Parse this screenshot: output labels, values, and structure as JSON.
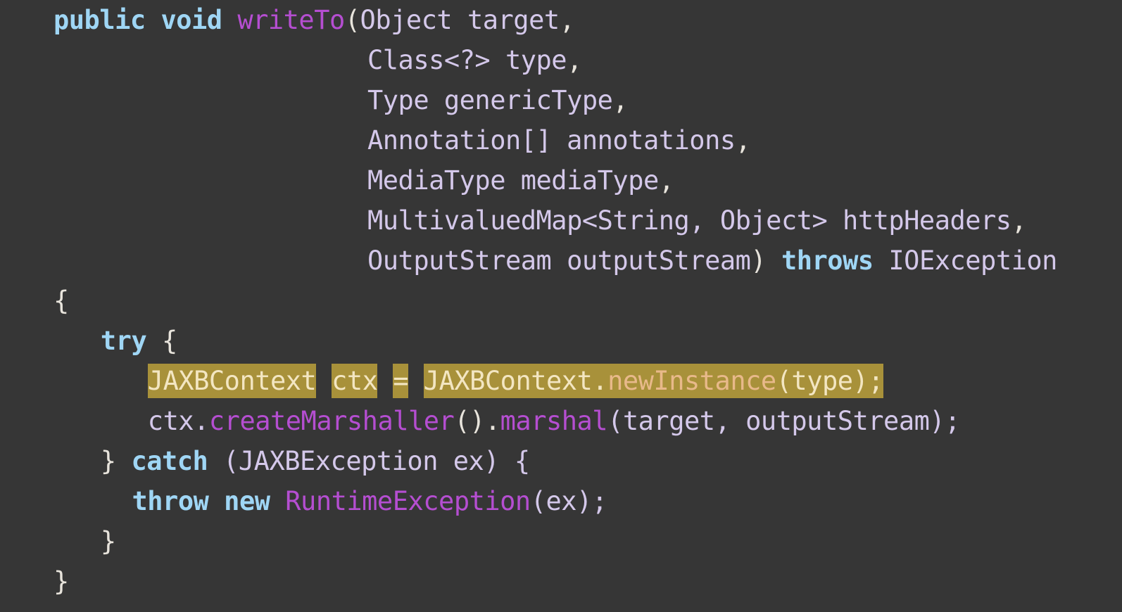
{
  "code": {
    "lines": [
      {
        "indent": 0,
        "tokens": [
          {
            "text": "public",
            "kind": "kw"
          },
          {
            "text": " ",
            "kind": "pu"
          },
          {
            "text": "void",
            "kind": "kw"
          },
          {
            "text": " ",
            "kind": "pu"
          },
          {
            "text": "writeTo",
            "kind": "fn"
          },
          {
            "text": "(",
            "kind": "pu"
          },
          {
            "text": "Object target",
            "kind": "ty"
          },
          {
            "text": ",",
            "kind": "pu"
          }
        ]
      },
      {
        "indent": 20,
        "tokens": [
          {
            "text": "Class<?> type",
            "kind": "ty"
          },
          {
            "text": ",",
            "kind": "pu"
          }
        ]
      },
      {
        "indent": 20,
        "tokens": [
          {
            "text": "Type genericType",
            "kind": "ty"
          },
          {
            "text": ",",
            "kind": "pu"
          }
        ]
      },
      {
        "indent": 20,
        "tokens": [
          {
            "text": "Annotation[] annotations",
            "kind": "ty"
          },
          {
            "text": ",",
            "kind": "pu"
          }
        ]
      },
      {
        "indent": 20,
        "tokens": [
          {
            "text": "MediaType mediaType",
            "kind": "ty"
          },
          {
            "text": ",",
            "kind": "pu"
          }
        ]
      },
      {
        "indent": 20,
        "tokens": [
          {
            "text": "MultivaluedMap<String, Object> httpHeaders",
            "kind": "ty"
          },
          {
            "text": ",",
            "kind": "pu"
          }
        ]
      },
      {
        "indent": 20,
        "tokens": [
          {
            "text": "OutputStream outputStream",
            "kind": "ty"
          },
          {
            "text": ") ",
            "kind": "pu"
          },
          {
            "text": "throws",
            "kind": "kw"
          },
          {
            "text": " ",
            "kind": "pu"
          },
          {
            "text": "IOException",
            "kind": "ty"
          }
        ]
      },
      {
        "indent": 0,
        "tokens": [
          {
            "text": "{",
            "kind": "pu"
          }
        ]
      },
      {
        "indent": 3,
        "tokens": [
          {
            "text": "try",
            "kind": "kw"
          },
          {
            "text": " {",
            "kind": "pu"
          }
        ]
      },
      {
        "indent": 6,
        "tokens": [
          {
            "text": "JAXBContext",
            "kind": "hl"
          },
          {
            "text": " ",
            "kind": "pu"
          },
          {
            "text": "ctx",
            "kind": "hl"
          },
          {
            "text": " ",
            "kind": "pu"
          },
          {
            "text": "=",
            "kind": "hl"
          },
          {
            "text": " ",
            "kind": "pu"
          },
          {
            "text": "JAXBContext.",
            "kind": "hl"
          },
          {
            "text": "newInstance",
            "kind": "hl-method"
          },
          {
            "text": "(type);",
            "kind": "hl"
          }
        ]
      },
      {
        "indent": 6,
        "tokens": [
          {
            "text": "ctx.",
            "kind": "id"
          },
          {
            "text": "createMarshaller",
            "kind": "fn"
          },
          {
            "text": "().",
            "kind": "pu"
          },
          {
            "text": "marshal",
            "kind": "fn"
          },
          {
            "text": "(target, outputStream);",
            "kind": "id"
          }
        ]
      },
      {
        "indent": 3,
        "tokens": [
          {
            "text": "} ",
            "kind": "pu"
          },
          {
            "text": "catch",
            "kind": "kw"
          },
          {
            "text": " (JAXBException ex) {",
            "kind": "id"
          }
        ]
      },
      {
        "indent": 5,
        "tokens": [
          {
            "text": "throw",
            "kind": "kw"
          },
          {
            "text": " ",
            "kind": "pu"
          },
          {
            "text": "new",
            "kind": "kw"
          },
          {
            "text": " ",
            "kind": "pu"
          },
          {
            "text": "RuntimeException",
            "kind": "fn"
          },
          {
            "text": "(ex);",
            "kind": "id"
          }
        ]
      },
      {
        "indent": 3,
        "tokens": [
          {
            "text": "}",
            "kind": "pu"
          }
        ]
      },
      {
        "indent": 0,
        "tokens": [
          {
            "text": "}",
            "kind": "pu"
          }
        ]
      }
    ],
    "colors": {
      "background": "#363636",
      "keyword": "#9fd6f5",
      "method": "#b54ed1",
      "identifier": "#d4c8ea",
      "highlight": "#a8913a"
    }
  }
}
